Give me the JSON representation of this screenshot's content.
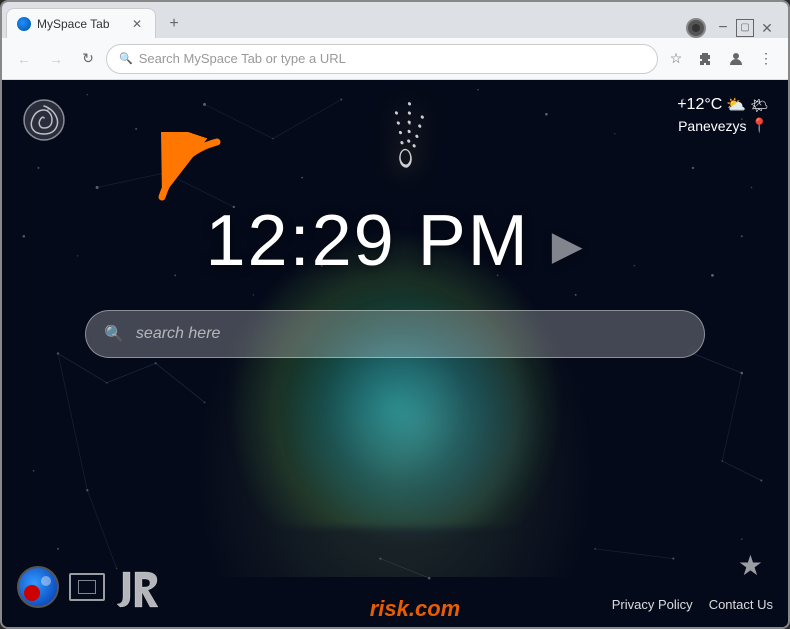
{
  "browser": {
    "tab_title": "MySpace Tab",
    "new_tab_label": "+",
    "address_placeholder": "Search MySpace Tab or type a URL",
    "back_btn": "←",
    "forward_btn": "→",
    "reload_btn": "↻"
  },
  "weather": {
    "temperature": "+12°C",
    "city": "Panevezys",
    "icon": "⛅"
  },
  "clock": {
    "time": "12:29 PM"
  },
  "search": {
    "placeholder": "search here"
  },
  "footer": {
    "privacy_policy": "Privacy Policy",
    "contact_us": "Contact Us"
  },
  "watermark": "risk.com"
}
